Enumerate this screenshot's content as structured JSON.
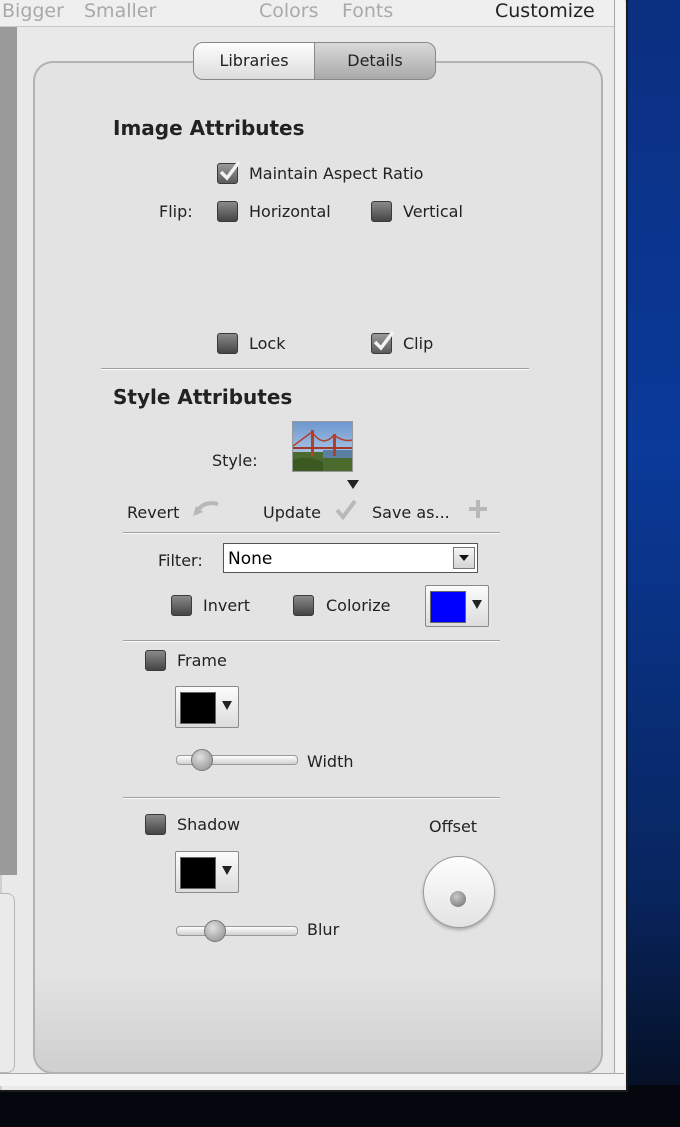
{
  "toolbar": {
    "bigger": "Bigger",
    "smaller": "Smaller",
    "colors": "Colors",
    "fonts": "Fonts",
    "customize": "Customize"
  },
  "tabs": {
    "libraries": "Libraries",
    "details": "Details"
  },
  "image_attributes": {
    "heading": "Image Attributes",
    "maintain_aspect": {
      "label": "Maintain Aspect Ratio",
      "checked": true
    },
    "flip_label": "Flip:",
    "horizontal": {
      "label": "Horizontal",
      "checked": false
    },
    "vertical": {
      "label": "Vertical",
      "checked": false
    },
    "lock": {
      "label": "Lock",
      "checked": false
    },
    "clip": {
      "label": "Clip",
      "checked": true
    }
  },
  "style_attributes": {
    "heading": "Style Attributes",
    "style_label": "Style:",
    "revert": "Revert",
    "update": "Update",
    "save_as": "Save as...",
    "filter_label": "Filter:",
    "filter_value": "None",
    "invert": {
      "label": "Invert",
      "checked": false
    },
    "colorize": {
      "label": "Colorize",
      "checked": false,
      "color": "#0000ff"
    },
    "frame": {
      "label": "Frame",
      "checked": false,
      "color": "#000000",
      "width_label": "Width",
      "width_value": 0.2
    },
    "shadow": {
      "label": "Shadow",
      "checked": false,
      "color": "#000000",
      "blur_label": "Blur",
      "blur_value": 0.3,
      "offset_label": "Offset"
    }
  }
}
